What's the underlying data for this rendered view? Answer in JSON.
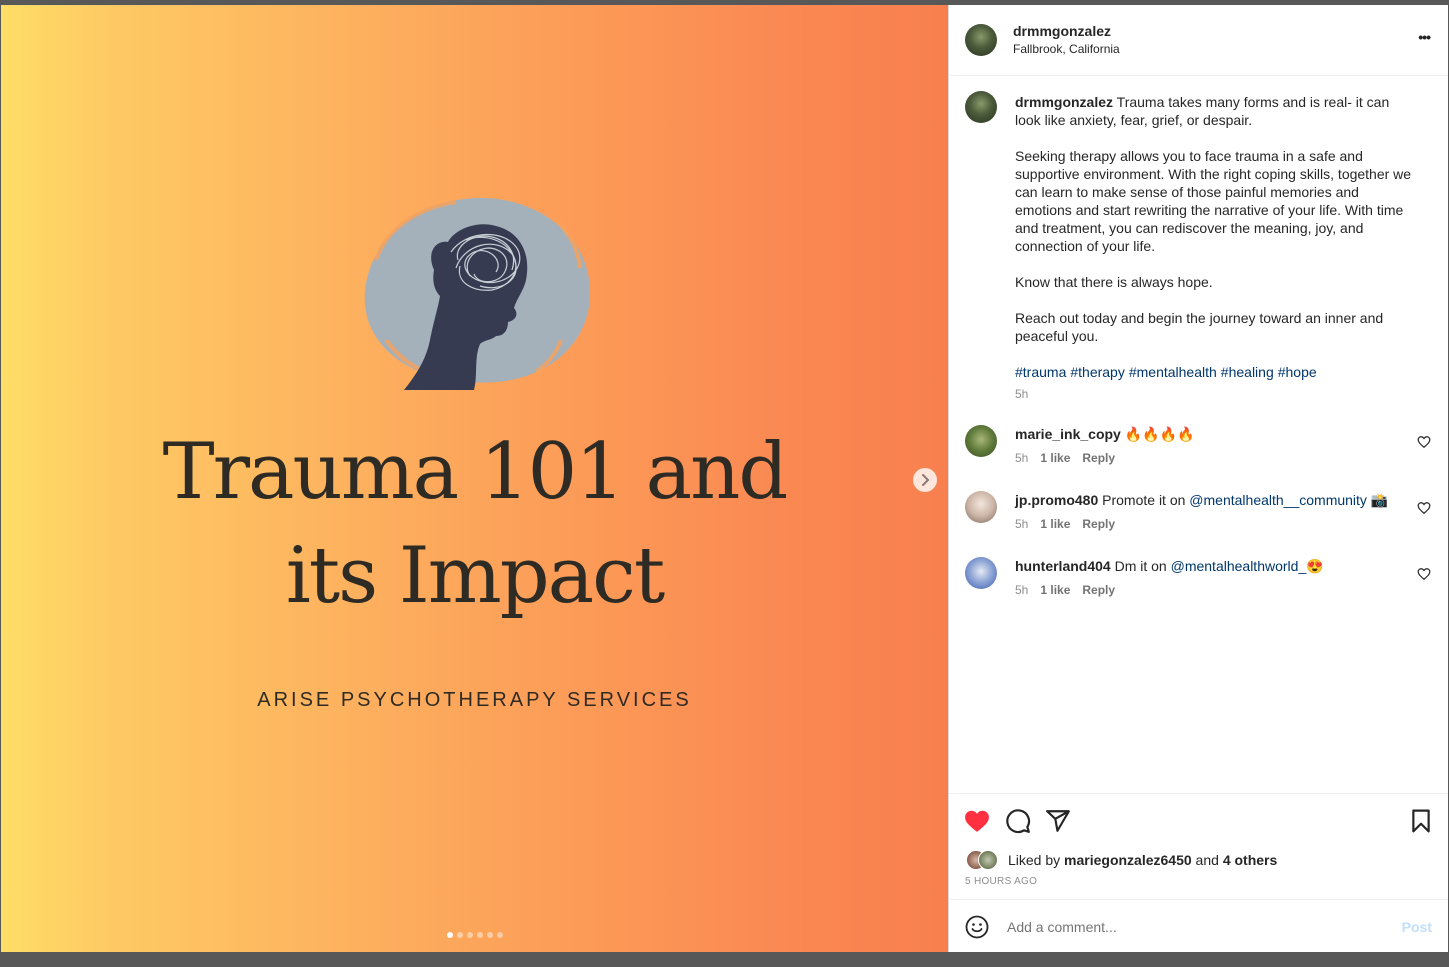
{
  "post": {
    "image": {
      "title_line1": "Trauma 101 and",
      "title_line2": "its Impact",
      "subtitle": "ARISE PSYCHOTHERAPY SERVICES",
      "carousel_count": 6,
      "carousel_active": 0
    },
    "header": {
      "username": "drmmgonzalez",
      "location": "Fallbrook, California",
      "more_label": "•••"
    },
    "caption": {
      "username": "drmmgonzalez",
      "first": "Trauma takes many forms and is real- it can look like anxiety, fear, grief, or despair.",
      "para2": "Seeking therapy allows you to face trauma in a safe and supportive environment. With the right coping skills, together we can learn to make sense of those painful memories and emotions and start rewriting the narrative of your life. With time and treatment, you can rediscover the meaning, joy, and connection of your life.",
      "para3": "Know that there is always hope.",
      "para4": "Reach out today and begin the journey toward an inner and peaceful you.",
      "hashtags": [
        "#trauma",
        "#therapy",
        "#mentalhealth",
        "#healing",
        "#hope"
      ],
      "time": "5h"
    },
    "comments": [
      {
        "username": "marie_ink_copy",
        "text": "🔥🔥🔥🔥",
        "mention": "",
        "suffix": "",
        "time": "5h",
        "likes": "1 like",
        "reply": "Reply"
      },
      {
        "username": "jp.promo480",
        "text": "Promote it on ",
        "mention": "@mentalhealth__community",
        "suffix": " 📸",
        "time": "5h",
        "likes": "1 like",
        "reply": "Reply"
      },
      {
        "username": "hunterland404",
        "text": "Dm it on ",
        "mention": "@mentalhealthworld_",
        "suffix": "😍",
        "time": "5h",
        "likes": "1 like",
        "reply": "Reply"
      }
    ],
    "likes": {
      "prefix": "Liked by ",
      "user": "mariegonzalez6450",
      "middle": " and ",
      "others": "4 others",
      "timestamp": "5 HOURS AGO"
    },
    "add_comment": {
      "placeholder": "Add a comment...",
      "post_label": "Post"
    },
    "colors": {
      "heart": "#ff3040",
      "link": "#00376b",
      "post_button": "#c0dffd",
      "silhouette": "#363b52",
      "circle": "#a4b1bb"
    }
  }
}
